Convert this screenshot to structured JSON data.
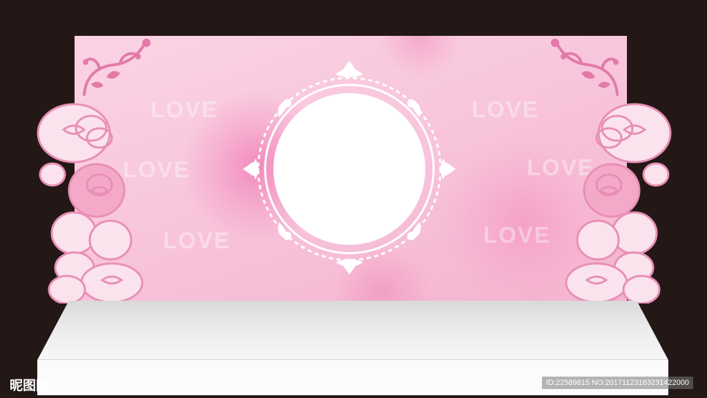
{
  "backdrop": {
    "love_text": [
      "LOVE",
      "LOVE",
      "LOVE",
      "LOVE",
      "LOVE",
      "LOVE"
    ],
    "colors": {
      "background": "#231816",
      "panel_light": "#fbd3e4",
      "panel_dark": "#f4b3cf",
      "rose_fill": "#f7d2e2",
      "rose_stroke": "#e88fb5",
      "frame": "#ffffff"
    }
  },
  "watermark": {
    "logo": "昵图网",
    "url": "www.nipic.com",
    "id_text": "ID:22589815 NO:20171123163231422000"
  }
}
